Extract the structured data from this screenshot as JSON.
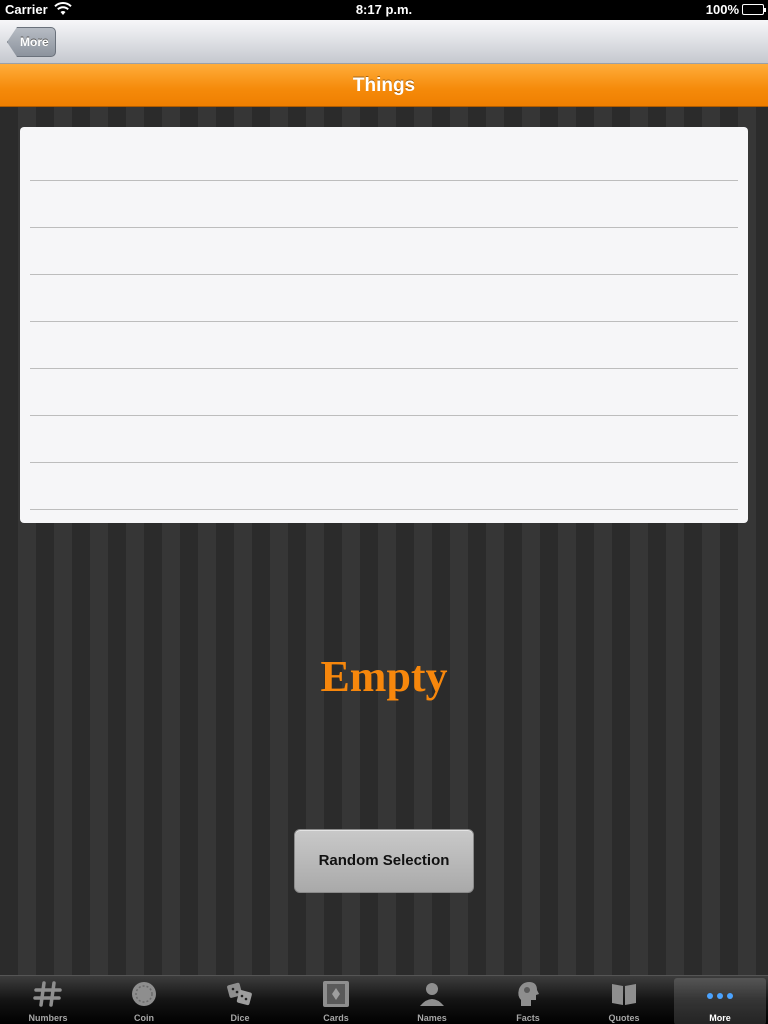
{
  "status_bar": {
    "carrier": "Carrier",
    "time": "8:17 p.m.",
    "battery": "100%"
  },
  "nav": {
    "back_label": "More"
  },
  "title": "Things",
  "list": {
    "rows": [
      "",
      "",
      "",
      "",
      "",
      "",
      "",
      ""
    ]
  },
  "empty_label": "Empty",
  "random_button_label": "Random Selection",
  "tabs": [
    {
      "label": "Numbers",
      "icon": "hash-icon"
    },
    {
      "label": "Coin",
      "icon": "coin-icon"
    },
    {
      "label": "Dice",
      "icon": "dice-icon"
    },
    {
      "label": "Cards",
      "icon": "cards-icon"
    },
    {
      "label": "Names",
      "icon": "person-icon"
    },
    {
      "label": "Facts",
      "icon": "head-icon"
    },
    {
      "label": "Quotes",
      "icon": "book-icon"
    },
    {
      "label": "More",
      "icon": "more-dots-icon",
      "selected": true
    }
  ],
  "colors": {
    "accent_orange": "#f58a0a",
    "empty_text": "#f7870c",
    "selected_dots": "#4aa3ff"
  }
}
